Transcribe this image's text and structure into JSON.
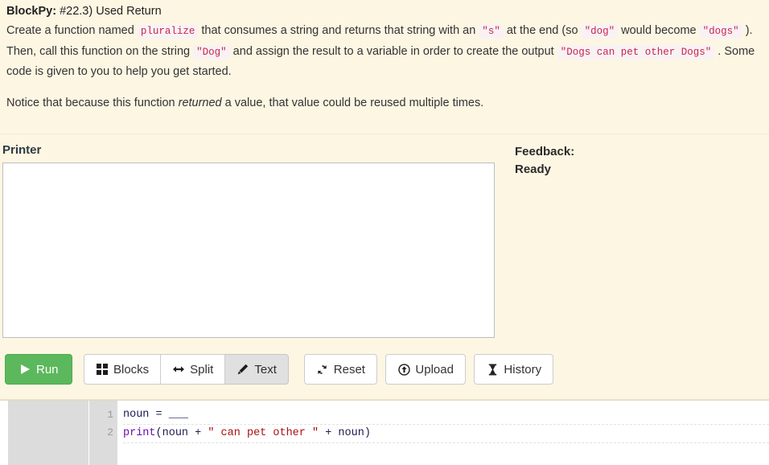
{
  "instructions": {
    "brand": "BlockPy:",
    "title": " #22.3) Used Return",
    "p1_seg1": "Create a function named ",
    "p1_code1": "pluralize",
    "p1_seg2": " that consumes a string and returns that string with an ",
    "p1_code2": "\"s\"",
    "p1_seg3": " at the end (so ",
    "p1_code3": "\"dog\"",
    "p1_seg4": " would become ",
    "p1_code4": "\"dogs\"",
    "p1_seg5": " ). Then, call this function on the string ",
    "p1_code5": "\"Dog\"",
    "p1_seg6": " and assign the result to a variable in order to create the output ",
    "p1_code6": "\"Dogs can pet other Dogs\"",
    "p1_seg7": " . Some code is given to you to help you get started.",
    "p2_seg1": "Notice that because this function ",
    "p2_em": "returned",
    "p2_seg2": " a value, that value could be reused multiple times."
  },
  "printer": {
    "label": "Printer",
    "value": "",
    "placeholder": ""
  },
  "feedback": {
    "label": "Feedback:",
    "status": "Ready"
  },
  "toolbar": {
    "run": {
      "label": "Run",
      "icon": "play-icon"
    },
    "blocks": {
      "label": "Blocks",
      "icon": "grid-icon"
    },
    "split": {
      "label": "Split",
      "icon": "arrows-horizontal-icon"
    },
    "text": {
      "label": "Text",
      "icon": "pencil-icon",
      "active": true
    },
    "reset": {
      "label": "Reset",
      "icon": "refresh-icon"
    },
    "upload": {
      "label": "Upload",
      "icon": "upload-circle-icon"
    },
    "history": {
      "label": "History",
      "icon": "hourglass-icon"
    }
  },
  "editor": {
    "line_numbers": [
      "1",
      "2"
    ],
    "lines": [
      [
        {
          "t": "noun",
          "c": "tok-name"
        },
        {
          "t": " ",
          "c": "tok-blank"
        },
        {
          "t": "=",
          "c": "tok-op"
        },
        {
          "t": " ",
          "c": "tok-blank"
        },
        {
          "t": "___",
          "c": "tok-blank"
        }
      ],
      [
        {
          "t": "print",
          "c": "tok-builtin"
        },
        {
          "t": "(",
          "c": "tok-punc"
        },
        {
          "t": "noun",
          "c": "tok-name"
        },
        {
          "t": " ",
          "c": "tok-blank"
        },
        {
          "t": "+",
          "c": "tok-op"
        },
        {
          "t": " ",
          "c": "tok-blank"
        },
        {
          "t": "\" can pet other \"",
          "c": "tok-string"
        },
        {
          "t": " ",
          "c": "tok-blank"
        },
        {
          "t": "+",
          "c": "tok-op"
        },
        {
          "t": " ",
          "c": "tok-blank"
        },
        {
          "t": "noun",
          "c": "tok-name"
        },
        {
          "t": ")",
          "c": "tok-punc"
        }
      ]
    ]
  },
  "colors": {
    "page_background": "#fdf6e3",
    "run_button": "#5cb85c",
    "inline_code_text": "#c7254e",
    "inline_code_background": "#f9f2f4",
    "active_button": "#e0e0e0",
    "editor_gutter": "#dcdcdc",
    "code_string": "#aa1111",
    "code_builtin": "#6a0dad"
  }
}
